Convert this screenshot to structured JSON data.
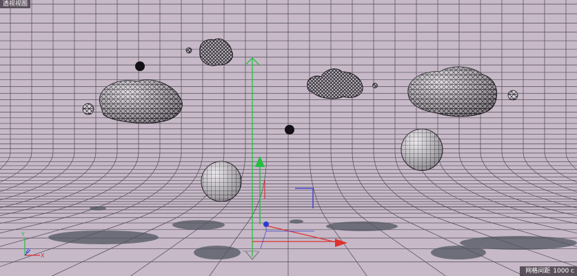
{
  "viewport": {
    "label": "透视视图",
    "grid_spacing_label": "网格间距",
    "grid_spacing_value": "1000 c"
  },
  "colors": {
    "background": "#c7b9c8",
    "grid_line": "#3a3440",
    "axis_x": "#e03030",
    "axis_y": "#22c040",
    "axis_z": "#2c3ad0",
    "shadow": "#4f5560"
  },
  "scene_objects": [
    "cloud",
    "cloud",
    "cloud",
    "cloud",
    "sphere",
    "sphere",
    "small-sphere",
    "small-sphere",
    "world-axis-gizmo",
    "null-object",
    "view-axis-indicator"
  ]
}
